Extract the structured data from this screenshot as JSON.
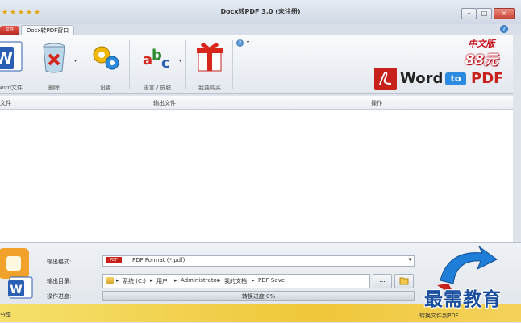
{
  "window": {
    "title": "Docx转PDF 3.0 (未注册)",
    "controls": {
      "minimize": "–",
      "maximize": "□",
      "close": "×"
    }
  },
  "tabs": {
    "red_tab_label": "文件",
    "active_tab_label": "Docx转PDF窗口"
  },
  "toolbar": {
    "items": [
      {
        "label": "Word文件",
        "icon": "word-file-icon"
      },
      {
        "label": "删除",
        "icon": "recycle-bin-icon"
      },
      {
        "label": "设置",
        "icon": "gears-icon"
      },
      {
        "label": "语言 / 皮肤",
        "icon": "abc-language-icon"
      },
      {
        "label": "我要购买",
        "icon": "gift-box-icon"
      }
    ],
    "help_icon": "help-icon"
  },
  "promo": {
    "edition": "中文版",
    "price": "88元",
    "word": "Word",
    "to": "to",
    "pdf": "PDF"
  },
  "file_list": {
    "columns": [
      "文件",
      "输出文件",
      "操作"
    ]
  },
  "settings": {
    "format_label": "输出格式:",
    "format_badge": "PDF",
    "format_value": "PDF Format (*.pdf)",
    "dir_label": "输出目录:",
    "dir_path": [
      "系统 (C:)",
      "用户",
      "Administrator",
      "我的文档",
      "PDF Save"
    ],
    "browse_label": "...",
    "progress_label": "操作进度:",
    "progress_text": "转换进度 0%",
    "progress_value": 0
  },
  "convert": {
    "label": "转换文件到PDF"
  },
  "status": {
    "text": "分享"
  },
  "watermark": "最需教育",
  "colors": {
    "accent_red": "#c8201a",
    "accent_blue": "#1a4f9e",
    "band_yellow": "#efc73a"
  }
}
